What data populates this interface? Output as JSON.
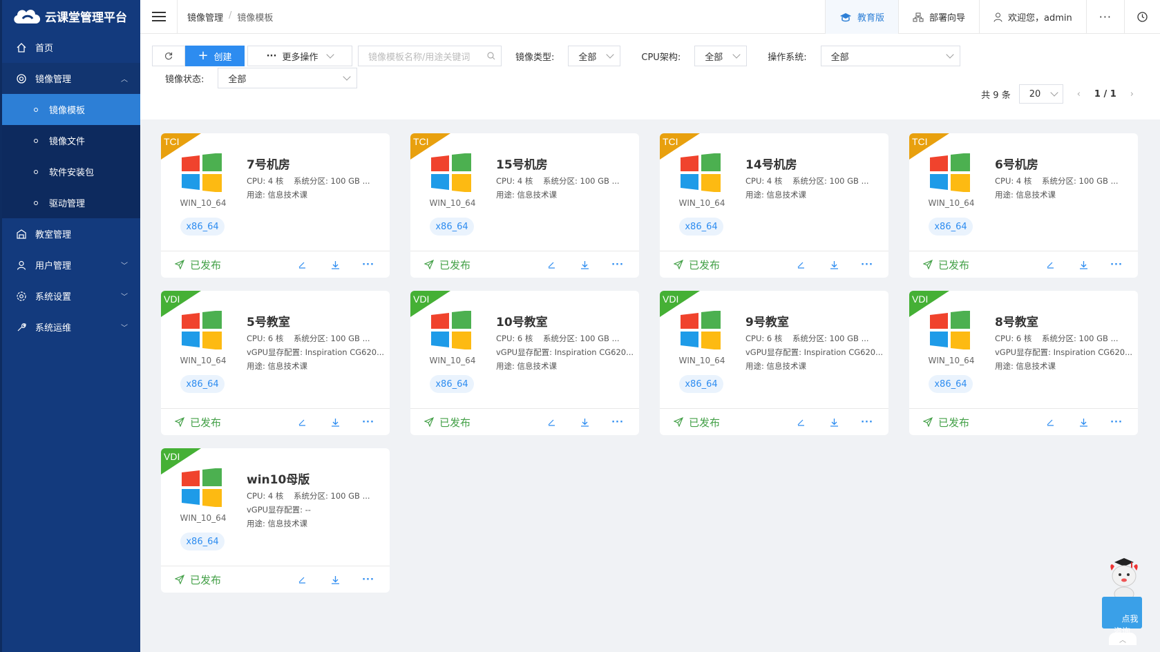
{
  "app": {
    "title": "云课堂管理平台"
  },
  "sidebar": {
    "items": [
      {
        "label": "首页",
        "icon": "home-icon"
      },
      {
        "label": "镜像管理",
        "icon": "image-manage-icon"
      },
      {
        "label": "教室管理",
        "icon": "classroom-icon"
      },
      {
        "label": "用户管理",
        "icon": "user-icon"
      },
      {
        "label": "系统设置",
        "icon": "settings-icon"
      },
      {
        "label": "系统运维",
        "icon": "tools-icon"
      }
    ],
    "sub_items": [
      "镜像模板",
      "镜像文件",
      "软件安装包",
      "驱动管理"
    ]
  },
  "header": {
    "breadcrumb": [
      "镜像管理",
      "镜像模板"
    ],
    "edition": "教育版",
    "deploy_guide": "部署向导",
    "welcome": "欢迎您，admin"
  },
  "toolbar": {
    "create_label": "创建",
    "more_label": "更多操作",
    "search_placeholder": "镜像模板名称/用途关键词",
    "filters": {
      "image_type_label": "镜像类型:",
      "image_type_value": "全部",
      "cpu_label": "CPU架构:",
      "cpu_value": "全部",
      "os_label": "操作系统:",
      "os_value": "全部",
      "status_label": "镜像状态:",
      "status_value": "全部"
    }
  },
  "pagination": {
    "total": "共 9 条",
    "page_size": "20",
    "page": "1 / 1"
  },
  "cards": [
    {
      "type": "TCI",
      "title": "7号机房",
      "cpu": "CPU:  4 核",
      "disk": "系统分区:  100 GB ...",
      "vgpu": "",
      "usage": "用途:  信息技术课",
      "os": "WIN_10_64",
      "arch": "x86_64",
      "status": "已发布"
    },
    {
      "type": "TCI",
      "title": "15号机房",
      "cpu": "CPU:  4 核",
      "disk": "系统分区:  100 GB ...",
      "vgpu": "",
      "usage": "用途:  信息技术课",
      "os": "WIN_10_64",
      "arch": "x86_64",
      "status": "已发布"
    },
    {
      "type": "TCI",
      "title": "14号机房",
      "cpu": "CPU:  4 核",
      "disk": "系统分区:  100 GB ...",
      "vgpu": "",
      "usage": "用途:  信息技术课",
      "os": "WIN_10_64",
      "arch": "x86_64",
      "status": "已发布"
    },
    {
      "type": "TCI",
      "title": "6号机房",
      "cpu": "CPU:  4 核",
      "disk": "系统分区:  100 GB ...",
      "vgpu": "",
      "usage": "用途:  信息技术课",
      "os": "WIN_10_64",
      "arch": "x86_64",
      "status": "已发布"
    },
    {
      "type": "VDI",
      "title": "5号教室",
      "cpu": "CPU:  6 核",
      "disk": "系统分区:  100 GB ...",
      "vgpu": "vGPU显存配置:  Inspiration CG620...",
      "usage": "用途:  信息技术课",
      "os": "WIN_10_64",
      "arch": "x86_64",
      "status": "已发布"
    },
    {
      "type": "VDI",
      "title": "10号教室",
      "cpu": "CPU:  6 核",
      "disk": "系统分区:  100 GB ...",
      "vgpu": "vGPU显存配置:  Inspiration CG620...",
      "usage": "用途:  信息技术课",
      "os": "WIN_10_64",
      "arch": "x86_64",
      "status": "已发布"
    },
    {
      "type": "VDI",
      "title": "9号教室",
      "cpu": "CPU:  6 核",
      "disk": "系统分区:  100 GB ...",
      "vgpu": "vGPU显存配置:  Inspiration CG620...",
      "usage": "用途:  信息技术课",
      "os": "WIN_10_64",
      "arch": "x86_64",
      "status": "已发布"
    },
    {
      "type": "VDI",
      "title": "8号教室",
      "cpu": "CPU:  6 核",
      "disk": "系统分区:  100 GB ...",
      "vgpu": "vGPU显存配置:  Inspiration CG620...",
      "usage": "用途:  信息技术课",
      "os": "WIN_10_64",
      "arch": "x86_64",
      "status": "已发布"
    },
    {
      "type": "VDI",
      "title": "win10母版",
      "cpu": "CPU:  4 核",
      "disk": "系统分区:  100 GB ...",
      "vgpu": "vGPU显存配置:  --",
      "usage": "用途:  信息技术课",
      "os": "WIN_10_64",
      "arch": "x86_64",
      "status": "已发布"
    }
  ],
  "mascot": {
    "label": "点我\n咨询"
  },
  "colors": {
    "sidebar": "#133a7d",
    "active": "#2d7fd6",
    "tci": "#e8a00e",
    "vdi": "#45b035",
    "published": "#43a047"
  }
}
